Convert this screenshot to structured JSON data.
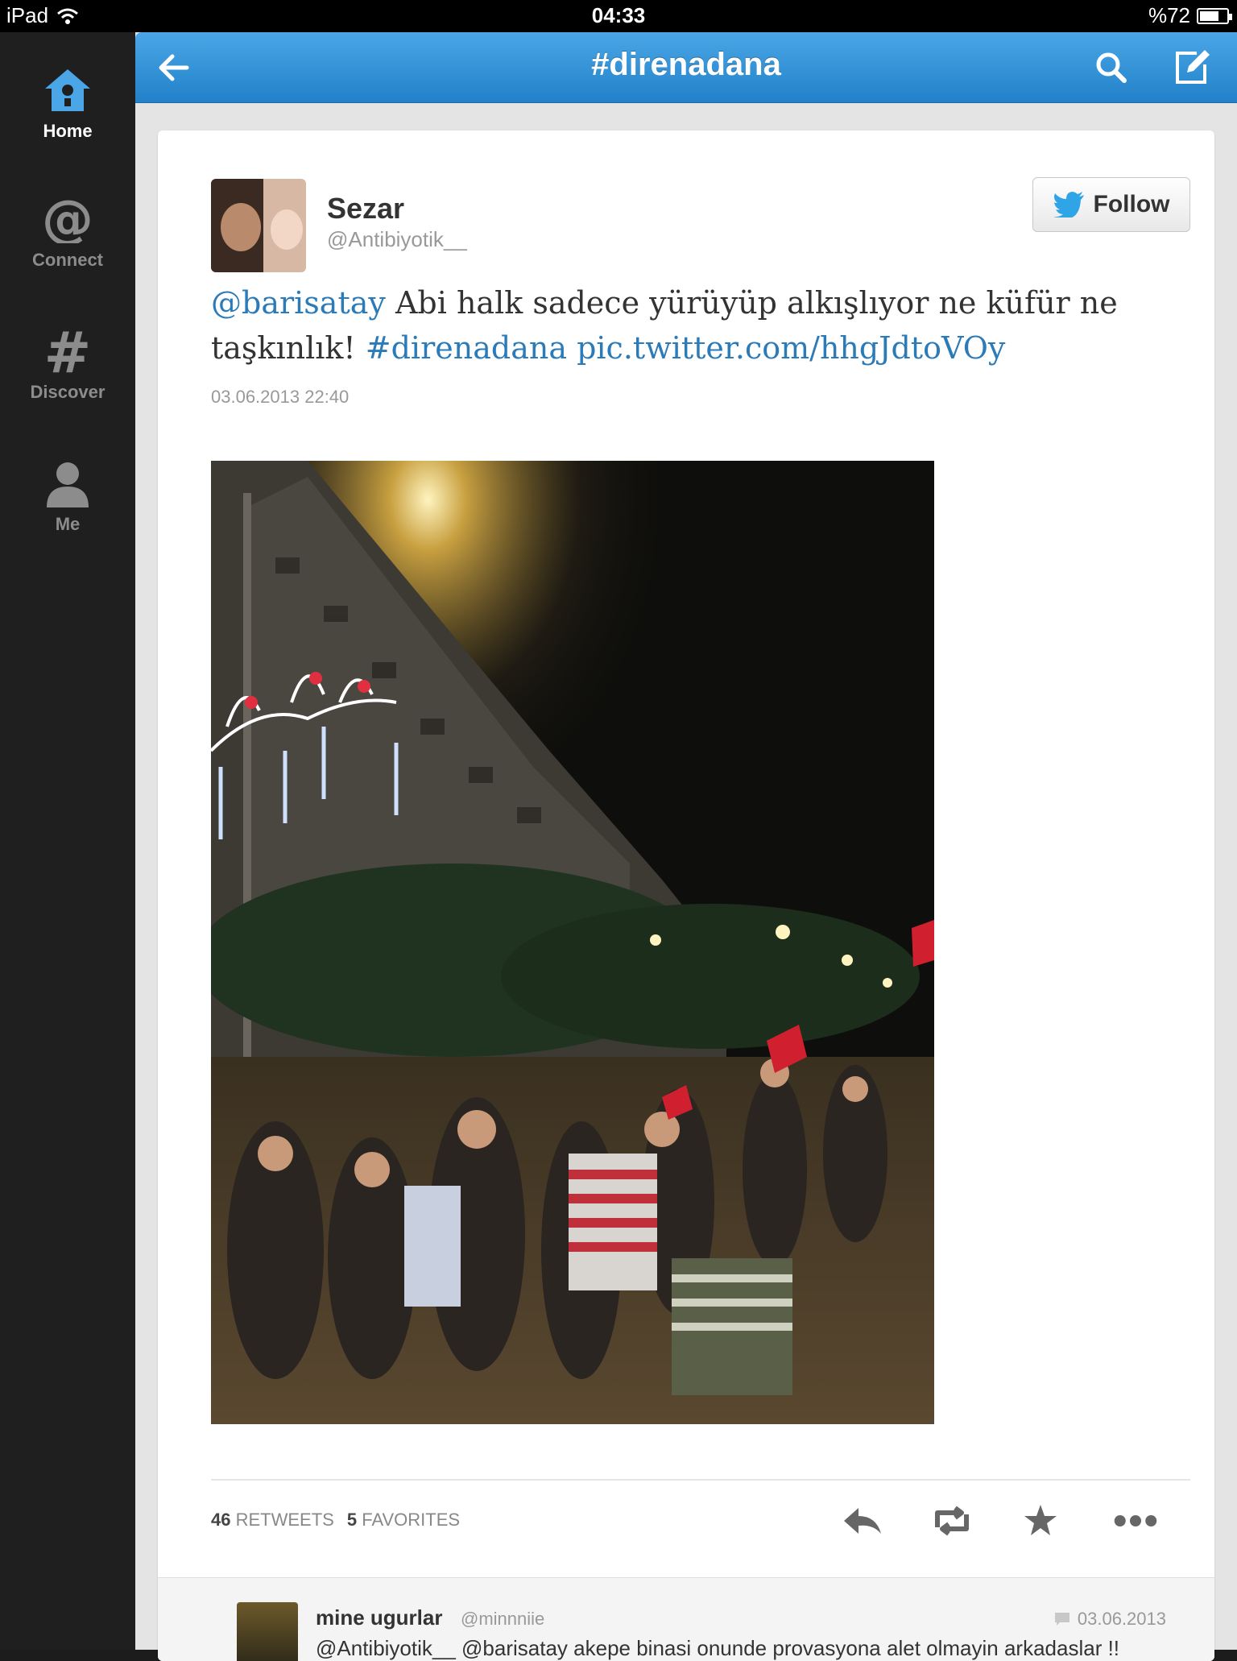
{
  "status_bar": {
    "device": "iPad",
    "time": "04:33",
    "battery": "%72",
    "battery_level": 0.72
  },
  "sidebar": {
    "items": [
      {
        "label": "Home",
        "icon": "home-icon",
        "active": true
      },
      {
        "label": "Connect",
        "icon": "at-icon",
        "active": false
      },
      {
        "label": "Discover",
        "icon": "hash-icon",
        "active": false
      },
      {
        "label": "Me",
        "icon": "person-icon",
        "active": false
      }
    ]
  },
  "topbar": {
    "title": "#direnadana"
  },
  "tweet": {
    "author_name": "Sezar",
    "author_handle": "@Antibiyotik__",
    "follow_label": "Follow",
    "text_mention": "@barisatay",
    "text_body": " Abi halk sadece yürüyüp alkışlıyor ne küfür ne taşkınlık! ",
    "text_hashtag": "#direnadana",
    "text_space": " ",
    "text_link": "pic.twitter.com/hhgJdtoVOy",
    "date": "03.06.2013 22:40",
    "retweet_count": "46",
    "retweet_label": "RETWEETS",
    "favorite_count": "5",
    "favorite_label": "FAVORITES"
  },
  "reply": {
    "name": "mine ugurlar",
    "handle": "@minnniie",
    "date": "03.06.2013",
    "text": "@Antibiyotik__ @barisatay akepe binasi onunde provasyona alet olmayin arkadaslar !! Sorun orda ! Amacimizdan sasmamaliyiz!!!"
  },
  "colors": {
    "accent": "#2b7bb9",
    "topbar": "#2a8bd3",
    "sidebar": "#1f1f1f"
  }
}
